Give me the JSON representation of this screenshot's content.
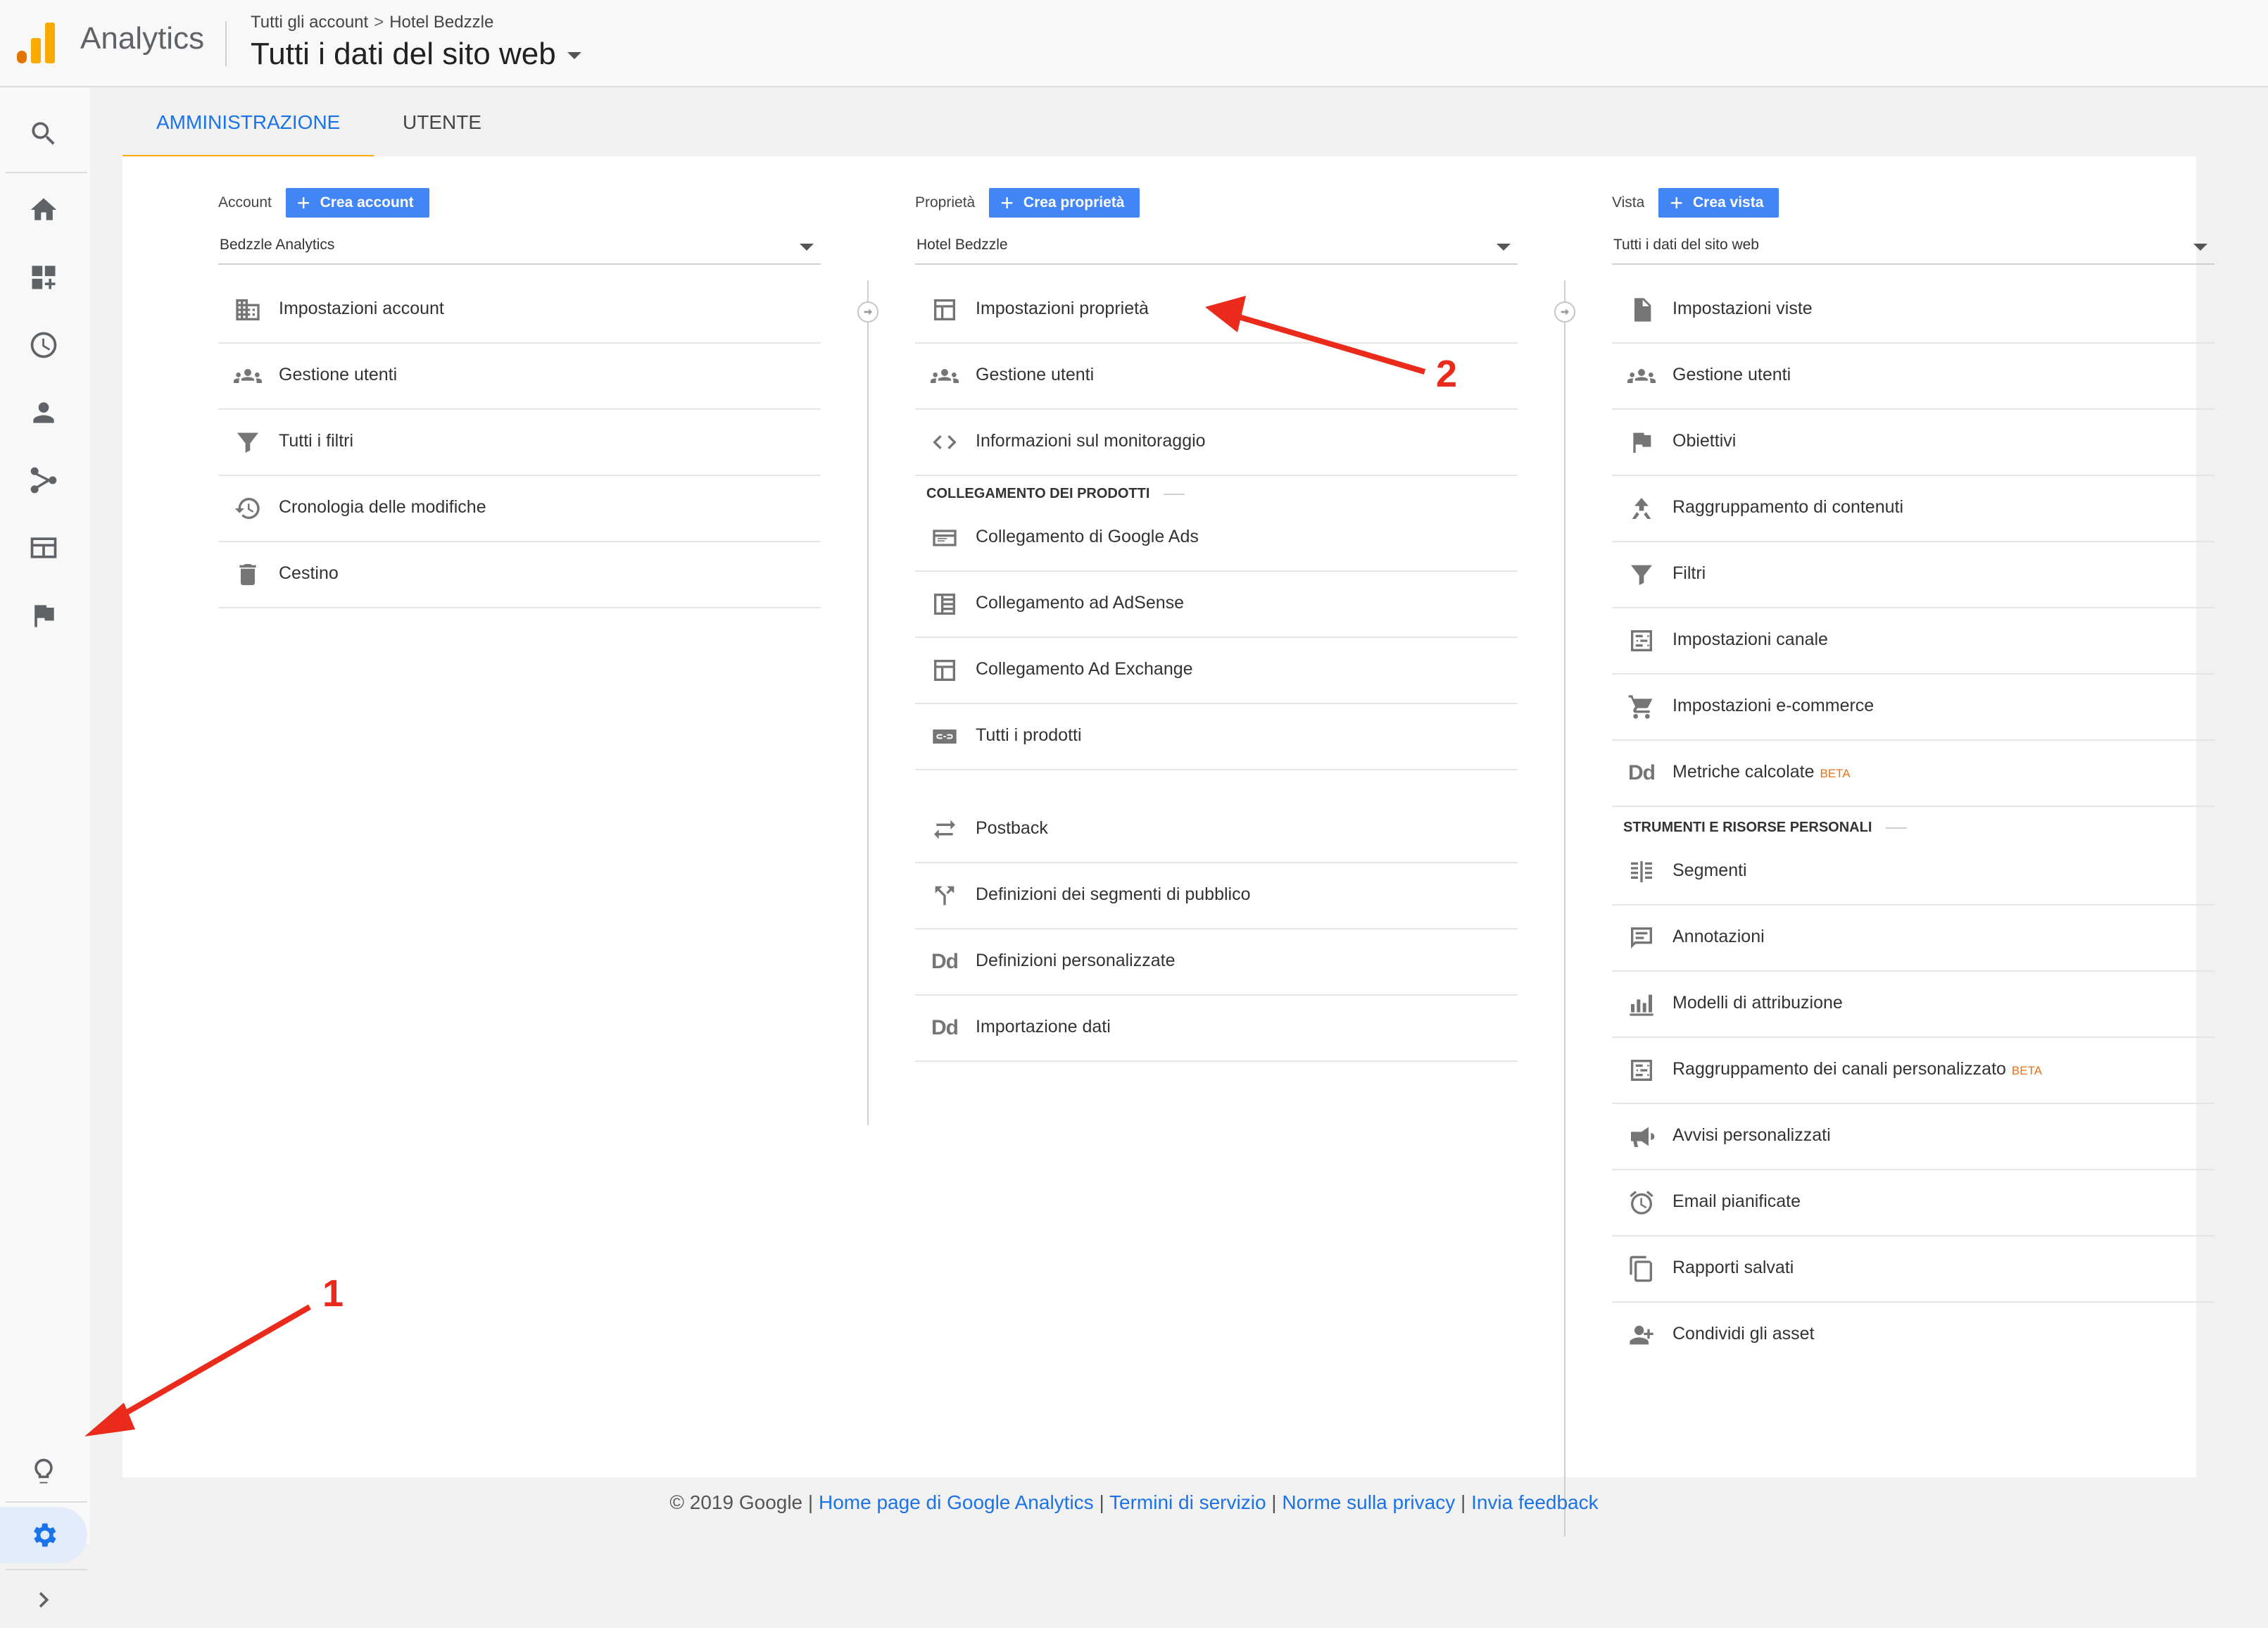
{
  "header": {
    "app_name": "Analytics",
    "breadcrumb_account": "Tutti gli account",
    "breadcrumb_separator": ">",
    "breadcrumb_property": "Hotel Bedzzle",
    "view_title": "Tutti i dati del sito web"
  },
  "rail": {
    "items": [
      {
        "icon": "search-icon"
      },
      {
        "icon": "home-icon"
      },
      {
        "icon": "customization-icon"
      },
      {
        "icon": "realtime-clock-icon"
      },
      {
        "icon": "audience-person-icon"
      },
      {
        "icon": "acquisition-icon"
      },
      {
        "icon": "behavior-icon"
      },
      {
        "icon": "conversions-flag-icon"
      },
      {
        "icon": "discover-lightbulb-icon"
      },
      {
        "icon": "admin-gear-icon",
        "active": true
      },
      {
        "icon": "expand-chevron-icon"
      }
    ]
  },
  "tabs": {
    "admin": "AMMINISTRAZIONE",
    "user": "UTENTE"
  },
  "account_col": {
    "label": "Account",
    "create_label": "Crea account",
    "selected": "Bedzzle Analytics",
    "items": [
      {
        "label": "Impostazioni account",
        "icon": "building-icon"
      },
      {
        "label": "Gestione utenti",
        "icon": "people-icon"
      },
      {
        "label": "Tutti i filtri",
        "icon": "filter-icon"
      },
      {
        "label": "Cronologia delle modifiche",
        "icon": "history-icon"
      },
      {
        "label": "Cestino",
        "icon": "trash-icon"
      }
    ]
  },
  "property_col": {
    "label": "Proprietà",
    "create_label": "Crea proprietà",
    "selected": "Hotel Bedzzle",
    "items_top": [
      {
        "label": "Impostazioni proprietà",
        "icon": "property-layout-icon"
      },
      {
        "label": "Gestione utenti",
        "icon": "people-icon"
      },
      {
        "label": "Informazioni sul monitoraggio",
        "icon": "code-brackets-icon"
      }
    ],
    "section_products": "COLLEGAMENTO DEI PRODOTTI",
    "items_products": [
      {
        "label": "Collegamento di Google Ads",
        "icon": "ads-card-icon"
      },
      {
        "label": "Collegamento ad AdSense",
        "icon": "adsense-icon"
      },
      {
        "label": "Collegamento Ad Exchange",
        "icon": "adexchange-layout-icon"
      },
      {
        "label": "Tutti i prodotti",
        "icon": "link-chain-icon"
      }
    ],
    "items_bottom": [
      {
        "label": "Postback",
        "icon": "postback-arrows-icon"
      },
      {
        "label": "Definizioni dei segmenti di pubblico",
        "icon": "audience-fork-icon"
      },
      {
        "label": "Definizioni personalizzate",
        "icon": "dd-icon"
      },
      {
        "label": "Importazione dati",
        "icon": "dd-icon"
      }
    ]
  },
  "view_col": {
    "label": "Vista",
    "create_label": "Crea vista",
    "selected": "Tutti i dati del sito web",
    "items_top": [
      {
        "label": "Impostazioni viste",
        "icon": "document-icon"
      },
      {
        "label": "Gestione utenti",
        "icon": "people-icon"
      },
      {
        "label": "Obiettivi",
        "icon": "flag-icon"
      },
      {
        "label": "Raggruppamento di contenuti",
        "icon": "content-grouping-icon"
      },
      {
        "label": "Filtri",
        "icon": "filter-icon"
      },
      {
        "label": "Impostazioni canale",
        "icon": "channel-settings-icon"
      },
      {
        "label": "Impostazioni e-commerce",
        "icon": "cart-icon"
      },
      {
        "label": "Metriche calcolate",
        "icon": "dd-icon",
        "badge": "BETA"
      }
    ],
    "section_personal": "STRUMENTI E RISORSE PERSONALI",
    "items_personal": [
      {
        "label": "Segmenti",
        "icon": "segments-icon"
      },
      {
        "label": "Annotazioni",
        "icon": "annotation-comment-icon"
      },
      {
        "label": "Modelli di attribuzione",
        "icon": "attribution-bars-icon"
      },
      {
        "label": "Raggruppamento dei canali personalizzato",
        "icon": "channel-settings-icon",
        "badge": "BETA"
      },
      {
        "label": "Avvisi personalizzati",
        "icon": "megaphone-icon"
      },
      {
        "label": "Email pianificate",
        "icon": "alarm-clock-icon"
      },
      {
        "label": "Rapporti salvati",
        "icon": "saved-report-icon"
      },
      {
        "label": "Condividi gli asset",
        "icon": "share-person-icon"
      }
    ]
  },
  "footer": {
    "copyright": "© 2019 Google",
    "sep": "|",
    "links": [
      "Home page di Google Analytics",
      "Termini di servizio",
      "Norme sulla privacy",
      "Invia feedback"
    ]
  },
  "annotations": {
    "marker_1": "1",
    "marker_2": "2",
    "color": "#ea2a1b"
  },
  "colors": {
    "accent_blue": "#1a73e8",
    "button_blue": "#4285f4",
    "tab_underline": "#f9ab00",
    "beta_orange": "#e8711a"
  }
}
